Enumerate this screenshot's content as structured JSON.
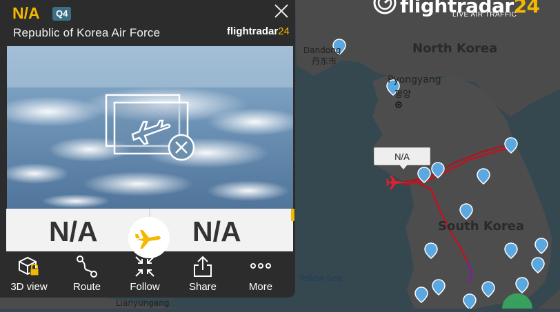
{
  "map": {
    "brand": {
      "name": "flightradar",
      "num": "24",
      "tagline": "LIVE AIR TRAFFIC"
    },
    "labels": {
      "north_korea": "North Korea",
      "south_korea": "South Korea",
      "dandong": "Dandong",
      "dandong_cn": "丹东市",
      "pyongyang": "Pyongyang",
      "pyongyang_kr": "평양",
      "yellow_sea": "Yellow Sea",
      "lianyungang": "Lianyungang"
    },
    "flight_tag": "N/A",
    "colors": {
      "land": "#4a4a4a",
      "sea": "#35474f",
      "track": "#c0131f",
      "track_end": "#7a2490",
      "pin": "#5ba7e0"
    }
  },
  "panel": {
    "callsign": "N/A",
    "badge": "Q4",
    "airline": "Republic of Korea Air Force",
    "brand": {
      "name": "flightradar",
      "num": "24"
    },
    "origin": "N/A",
    "destination": "N/A",
    "actions": [
      {
        "label": "3D view",
        "icon": "cube-lock-icon"
      },
      {
        "label": "Route",
        "icon": "route-icon"
      },
      {
        "label": "Follow",
        "icon": "follow-icon"
      },
      {
        "label": "Share",
        "icon": "share-icon"
      },
      {
        "label": "More",
        "icon": "more-icon"
      }
    ]
  }
}
